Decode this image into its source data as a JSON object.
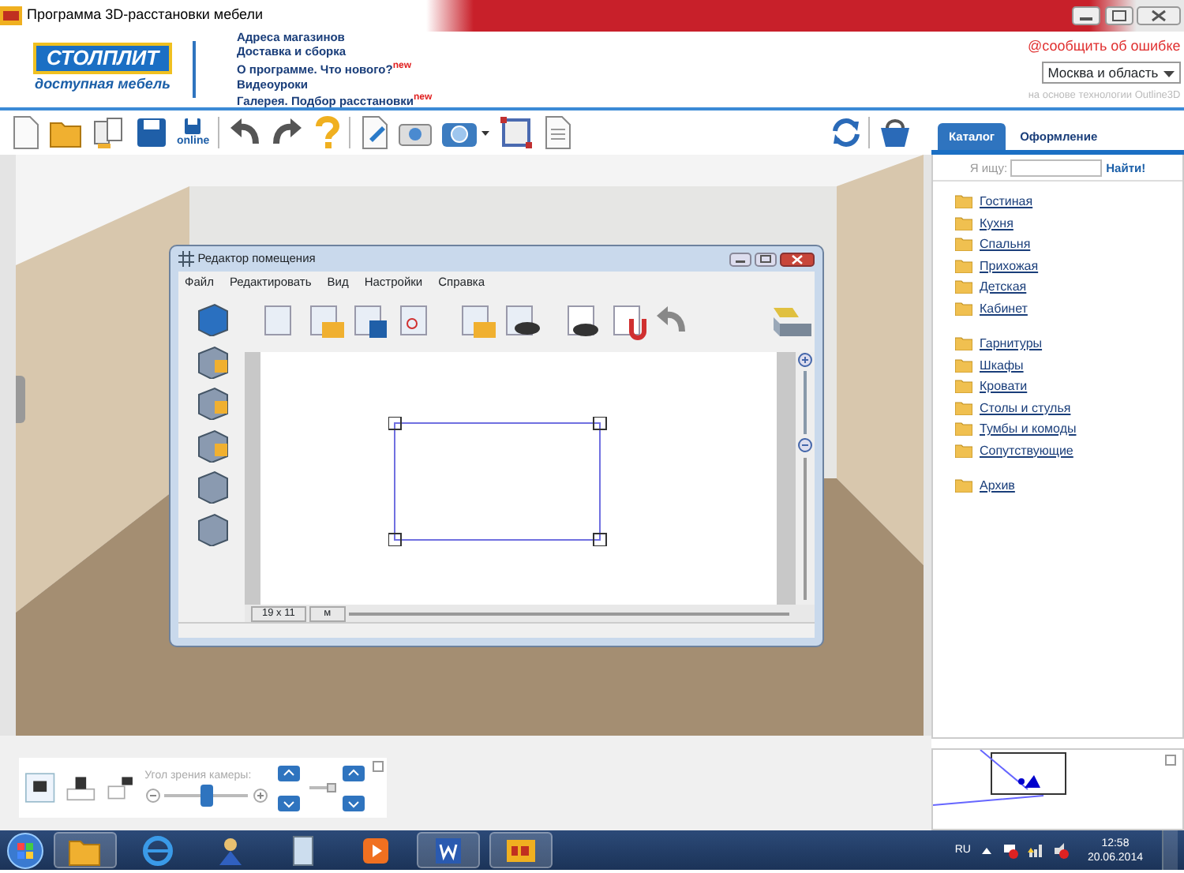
{
  "window": {
    "title": "Программа 3D-расстановки мебели"
  },
  "logo": {
    "brand": "СТОЛПЛИТ",
    "tagline": "доступная мебель"
  },
  "header_links": [
    {
      "text": "Адреса магазинов"
    },
    {
      "text": "Доставка и сборка"
    },
    {
      "text": "О программе.  Что нового?",
      "badge": "new"
    },
    {
      "text": "Видеоуроки"
    },
    {
      "text": "Галерея.  Подбор расстановки",
      "badge": "new"
    }
  ],
  "report_link": "@сообщить об ошибке",
  "region_select": {
    "value": "Москва и область"
  },
  "tech_note": "на основе технологии Outline3D",
  "toolbar": {
    "online_label": "online"
  },
  "catalog": {
    "tabs": [
      {
        "label": "Каталог",
        "selected": true
      },
      {
        "label": "Оформление",
        "selected": false
      }
    ],
    "search": {
      "label": "Я ищу:",
      "button": "Найти!"
    },
    "groups": [
      [
        "Гостиная",
        "Кухня",
        "Спальня",
        "Прихожая",
        "Детская",
        "Кабинет"
      ],
      [
        "Гарнитуры",
        "Шкафы",
        "Кровати",
        "Столы и стулья",
        "Тумбы и комоды",
        "Сопутствующие"
      ],
      [
        "Архив"
      ]
    ]
  },
  "editor": {
    "title": "Редактор помещения",
    "menu": [
      "Файл",
      "Редактировать",
      "Вид",
      "Настройки",
      "Справка"
    ],
    "size": "19 x 11",
    "unit": "м"
  },
  "camera": {
    "label": "Угол зрения камеры:",
    "angle": {
      "level": 0.5
    },
    "height": {
      "level": 0.9
    }
  },
  "taskbar": {
    "language": "RU",
    "time": "12:58",
    "date": "20.06.2014"
  }
}
